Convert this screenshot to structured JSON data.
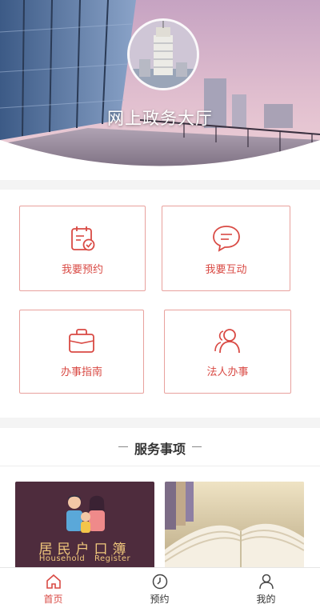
{
  "hero": {
    "title": "网上政务大厅"
  },
  "actions": [
    {
      "label": "我要预约",
      "icon": "calendar-check-icon"
    },
    {
      "label": "我要互动",
      "icon": "chat-bubble-icon"
    },
    {
      "label": "办事指南",
      "icon": "briefcase-icon"
    },
    {
      "label": "法人办事",
      "icon": "users-icon"
    }
  ],
  "services": {
    "title": "服务事项",
    "items": [
      {
        "title_cn": "居民户口簿",
        "title_en": "Household Register",
        "image": "family-illustration"
      },
      {
        "image": "open-book-photo"
      }
    ]
  },
  "tabbar": {
    "tabs": [
      {
        "label": "首页",
        "icon": "home-icon",
        "active": true
      },
      {
        "label": "预约",
        "icon": "clock-icon",
        "active": false
      },
      {
        "label": "我的",
        "icon": "person-icon",
        "active": false
      }
    ]
  },
  "colors": {
    "accent": "#d94a44",
    "card_border": "#e8a19d",
    "household_bg": "#4e2c3d",
    "household_text": "#f0c77c"
  }
}
